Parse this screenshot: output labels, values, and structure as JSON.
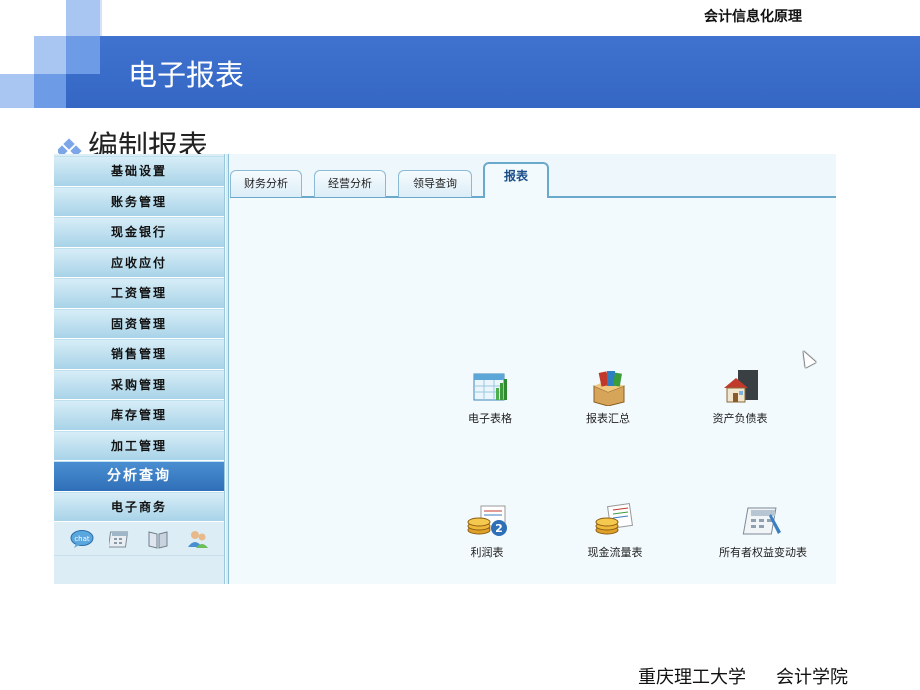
{
  "slide": {
    "course_title": "会计信息化原理",
    "banner_title": "电子报表",
    "subheading": "编制报表",
    "footer_school": "重庆理工大学",
    "footer_college": "会计学院"
  },
  "sidebar": {
    "items": [
      {
        "label": "基础设置"
      },
      {
        "label": "账务管理"
      },
      {
        "label": "现金银行"
      },
      {
        "label": "应收应付"
      },
      {
        "label": "工资管理"
      },
      {
        "label": "固资管理"
      },
      {
        "label": "销售管理"
      },
      {
        "label": "采购管理"
      },
      {
        "label": "库存管理"
      },
      {
        "label": "加工管理"
      },
      {
        "label": "分析查询",
        "active": true
      },
      {
        "label": "电子商务"
      }
    ],
    "bottom_icons": [
      "chat-icon",
      "calendar-icon",
      "book-icon",
      "users-icon"
    ]
  },
  "tabs": [
    {
      "label": "财务分析"
    },
    {
      "label": "经营分析"
    },
    {
      "label": "领导查询"
    },
    {
      "label": "报表",
      "active": true
    }
  ],
  "tiles": [
    {
      "label": "电子表格",
      "icon": "spreadsheet-icon"
    },
    {
      "label": "报表汇总",
      "icon": "report-summary-icon"
    },
    {
      "label": "资产负债表",
      "icon": "balance-sheet-icon"
    },
    {
      "label": "利润表",
      "icon": "income-statement-icon"
    },
    {
      "label": "现金流量表",
      "icon": "cash-flow-icon"
    },
    {
      "label": "所有者权益变动表",
      "icon": "equity-statement-icon"
    }
  ],
  "colors": {
    "banner": "#3566c4",
    "active_menu": "#2f6fb8",
    "tab_border": "#6aa8cc"
  }
}
